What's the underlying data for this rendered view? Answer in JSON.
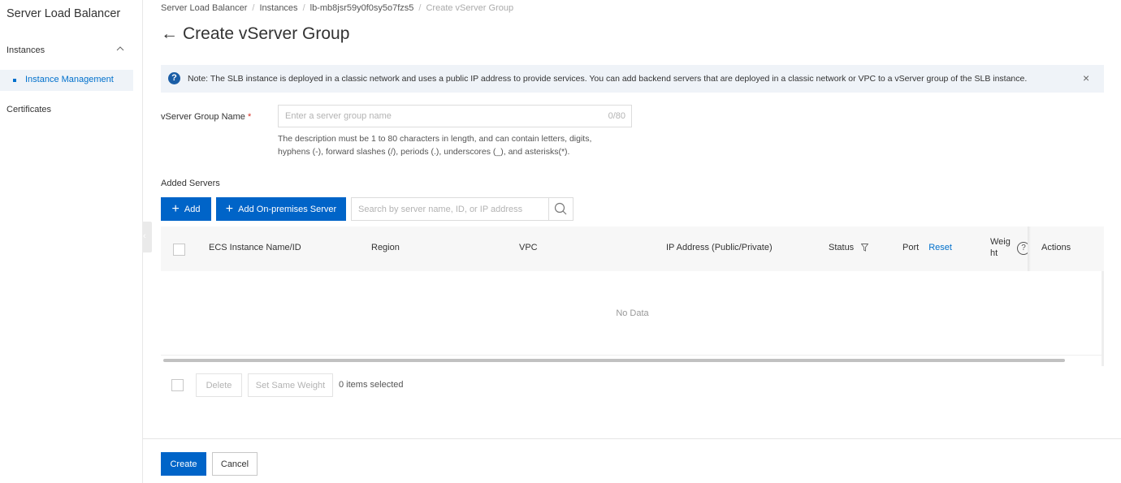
{
  "sidebar": {
    "title": "Server Load Balancer",
    "group_label": "Instances",
    "active_item": "Instance Management",
    "certificates": "Certificates"
  },
  "breadcrumb": {
    "items": [
      "Server Load Balancer",
      "Instances",
      "lb-mb8jsr59y0f0sy5o7fzs5"
    ],
    "current": "Create vServer Group"
  },
  "page": {
    "back_arrow": "←",
    "title": "Create vServer Group"
  },
  "notice": {
    "icon": "?",
    "text": "Note: The SLB instance is deployed in a classic network and uses a public IP address to provide services. You can add backend servers that are deployed in a classic network or VPC to a vServer group of the SLB instance.",
    "close": "×"
  },
  "form": {
    "name_label": "vServer Group Name",
    "required_mark": "*",
    "name_placeholder": "Enter a server group name",
    "name_value": "",
    "name_counter": "0/80",
    "hint_line1": "The description must be 1 to 80 characters in length, and can contain letters, digits,",
    "hint_line2": "hyphens (-), forward slashes (/), periods (.), underscores (_), and asterisks(*)."
  },
  "servers": {
    "section_label": "Added Servers",
    "add_label": "Add",
    "add_onprem_label": "Add On-premises Server",
    "search_placeholder": "Search by server name, ID, or IP address"
  },
  "table": {
    "columns": {
      "name": "ECS Instance Name/ID",
      "region": "Region",
      "vpc": "VPC",
      "ip": "IP Address (Public/Private)",
      "status": "Status",
      "port": "Port",
      "reset": "Reset",
      "weight_line1": "Weig",
      "weight_line2": "ht",
      "help": "?",
      "actions": "Actions"
    },
    "empty": "No Data"
  },
  "bulk": {
    "delete_label": "Delete",
    "same_weight_label": "Set Same Weight",
    "selected_text": "0 items selected"
  },
  "footer": {
    "create_label": "Create",
    "cancel_label": "Cancel"
  },
  "colors": {
    "primary": "#0064c8",
    "link": "#0070cc",
    "notice_bg": "#eff3f8",
    "required": "#d93026"
  }
}
